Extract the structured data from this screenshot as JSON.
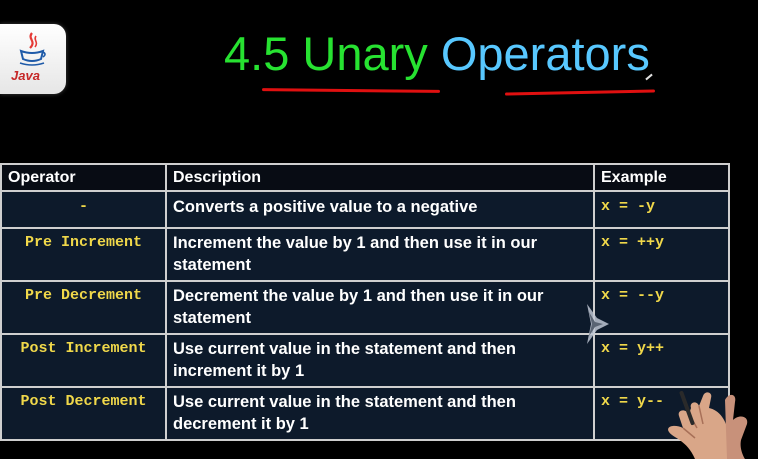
{
  "logo": {
    "text": "Java",
    "icon": "java-coffee-cup-icon"
  },
  "title": {
    "part1": "4.5 Unary",
    "part2": "Operators",
    "color1": "#27e231",
    "color2": "#58c8ff"
  },
  "table": {
    "headers": [
      "Operator",
      "Description",
      "Example"
    ],
    "rows": [
      {
        "operator": "-",
        "description": "Converts a positive value to a negative",
        "example": "x = -y"
      },
      {
        "operator": "Pre Increment",
        "description": "Increment the value by 1 and then use it in our statement",
        "example": "x = ++y"
      },
      {
        "operator": "Pre Decrement",
        "description": "Decrement the value by 1 and then use it in our statement",
        "example": "x = --y"
      },
      {
        "operator": "Post Increment",
        "description": "Use current value in the statement and then increment it by 1",
        "example": "x = y++"
      },
      {
        "operator": "Post Decrement",
        "description": "Use current value in the statement and then decrement it by 1",
        "example": "x = y--"
      }
    ]
  }
}
